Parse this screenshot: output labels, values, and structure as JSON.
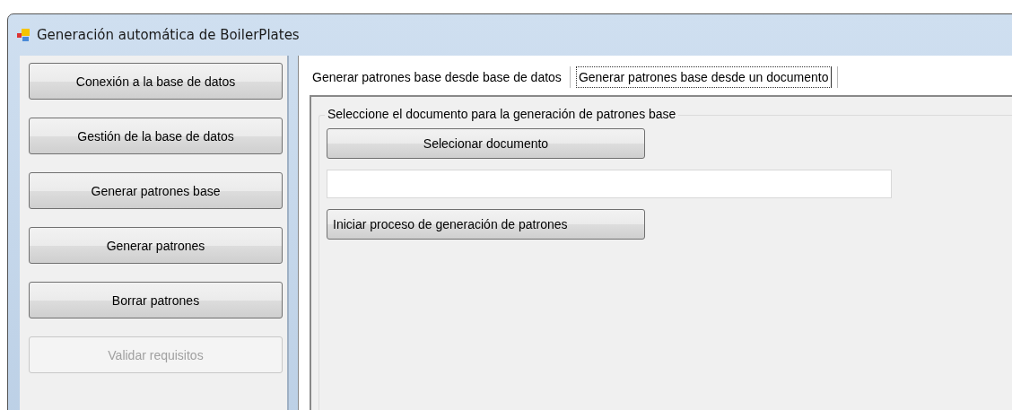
{
  "window": {
    "title": "Generación automática de BoilerPlates"
  },
  "sidebar": {
    "buttons": [
      {
        "label": "Conexión a la base de datos",
        "disabled": false
      },
      {
        "label": "Gestión de la base de datos",
        "disabled": false
      },
      {
        "label": "Generar patrones base",
        "disabled": false
      },
      {
        "label": "Generar patrones",
        "disabled": false
      },
      {
        "label": "Borrar patrones",
        "disabled": false
      },
      {
        "label": "Validar requisitos",
        "disabled": true
      }
    ]
  },
  "tabs": [
    {
      "label": "Generar patrones base desde base de datos",
      "selected": false
    },
    {
      "label": "Generar patrones base desde un documento",
      "selected": true
    }
  ],
  "group": {
    "legend": "Seleccione el documento para la generación de patrones base",
    "select_button": "Selecionar documento",
    "start_button": "Iniciar proceso de generación de patrones"
  }
}
